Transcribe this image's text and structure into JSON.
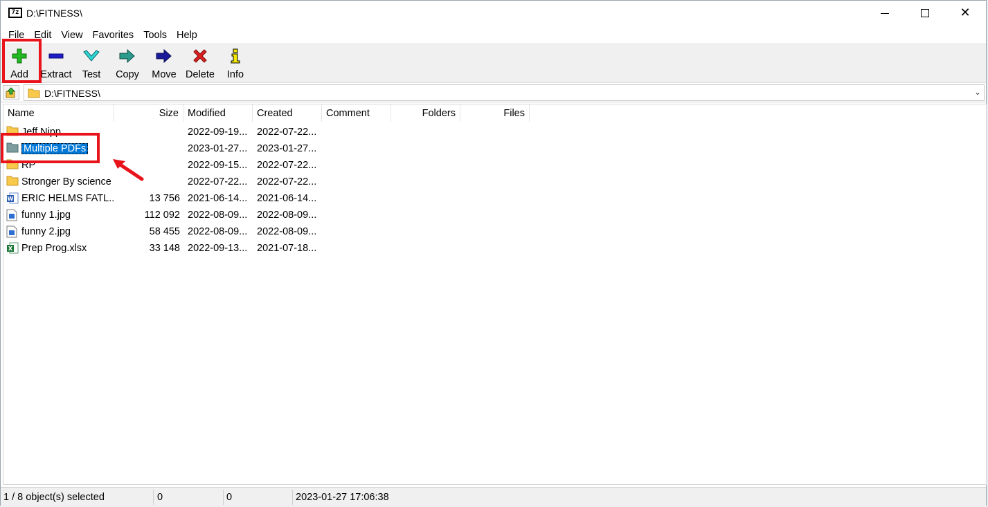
{
  "window": {
    "title": "D:\\FITNESS\\",
    "app_icon_text": "7z"
  },
  "menu": [
    "File",
    "Edit",
    "View",
    "Favorites",
    "Tools",
    "Help"
  ],
  "toolbar": {
    "add": "Add",
    "extract": "Extract",
    "test": "Test",
    "copy": "Copy",
    "move": "Move",
    "delete": "Delete",
    "info": "Info"
  },
  "address": {
    "path": "D:\\FITNESS\\"
  },
  "columns": {
    "name": "Name",
    "size": "Size",
    "modified": "Modified",
    "created": "Created",
    "comment": "Comment",
    "folders": "Folders",
    "files": "Files"
  },
  "rows": [
    {
      "name": "Jeff Nipp",
      "icon": "folder-icon",
      "size": "",
      "modified": "2022-09-19...",
      "created": "2022-07-22..."
    },
    {
      "name": "Multiple PDFs",
      "icon": "folder-icon",
      "size": "",
      "modified": "2023-01-27...",
      "created": "2023-01-27...",
      "selected": true
    },
    {
      "name": "RP",
      "icon": "folder-icon",
      "size": "",
      "modified": "2022-09-15...",
      "created": "2022-07-22..."
    },
    {
      "name": "Stronger By science",
      "icon": "folder-icon",
      "size": "",
      "modified": "2022-07-22...",
      "created": "2022-07-22..."
    },
    {
      "name": "ERIC HELMS FATL...",
      "icon": "word-doc-icon",
      "size": "13 756",
      "modified": "2021-06-14...",
      "created": "2021-06-14..."
    },
    {
      "name": "funny 1.jpg",
      "icon": "image-file-icon",
      "size": "112 092",
      "modified": "2022-08-09...",
      "created": "2022-08-09..."
    },
    {
      "name": "funny 2.jpg",
      "icon": "image-file-icon",
      "size": "58 455",
      "modified": "2022-08-09...",
      "created": "2022-08-09..."
    },
    {
      "name": "Prep Prog.xlsx",
      "icon": "excel-file-icon",
      "size": "33 148",
      "modified": "2022-09-13...",
      "created": "2021-07-18..."
    }
  ],
  "status": {
    "selection": "1 / 8 object(s) selected",
    "size": "0",
    "packed": "0",
    "datetime": "2023-01-27 17:06:38"
  },
  "colors": {
    "selection": "#0078d7",
    "annotation": "#e8131b",
    "folder": "#f8c94a"
  }
}
